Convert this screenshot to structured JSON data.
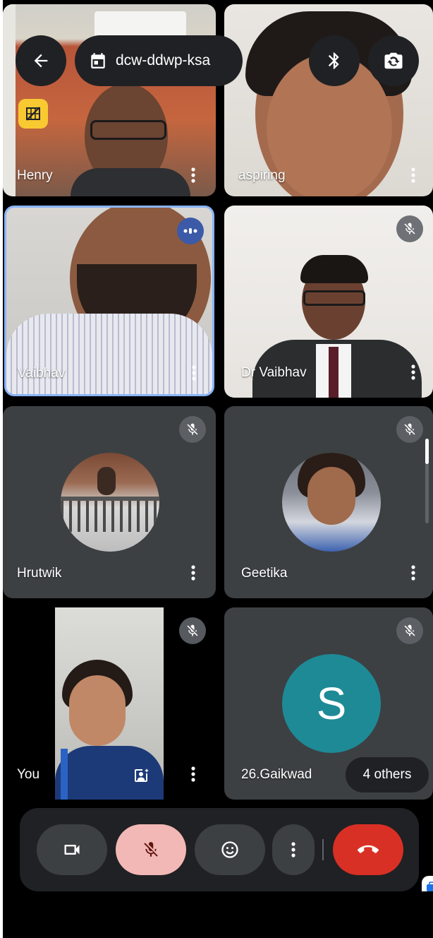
{
  "header": {
    "meeting_code": "dcw-ddwp-ksa",
    "back_icon": "arrow-back-icon",
    "calendar_icon": "calendar-icon",
    "bluetooth_icon": "bluetooth-icon",
    "switch_camera_icon": "switch-camera-icon"
  },
  "participants": [
    {
      "name": "Henry",
      "muted": false,
      "badge": "camera-off-badge"
    },
    {
      "name": "aspiring",
      "muted": false
    },
    {
      "name": "Vaibhav",
      "speaking": true,
      "active_speaker": true
    },
    {
      "name": "Dr Vaibhav",
      "muted": true
    },
    {
      "name": "Hrutwik",
      "muted": true
    },
    {
      "name": "Geetika",
      "muted": true
    },
    {
      "name": "You",
      "muted": true
    },
    {
      "name": "26.Gaikwad",
      "muted": true,
      "avatar_letter": "S",
      "avatar_color": "#1e8a96"
    }
  ],
  "others": {
    "label": "4 others"
  },
  "controls": {
    "camera": "videocam-icon",
    "mic": "mic-off-icon",
    "reactions": "emoji-icon",
    "more": "more-vert-icon",
    "hangup": "call-end-icon"
  },
  "colors": {
    "tile_bg": "#3c4043",
    "active_border": "#8ab4f8",
    "mic_active_bg": "#f2b8b5",
    "hangup_bg": "#d93025",
    "avatar_teal": "#1e8a96",
    "badge_yellow": "#f9c932"
  }
}
